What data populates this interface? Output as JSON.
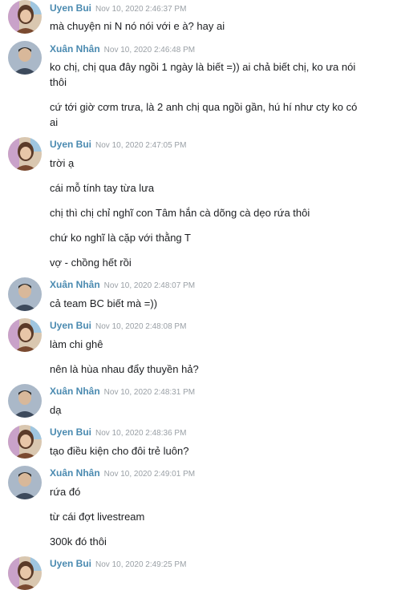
{
  "colors": {
    "sender_name": "#4a8ab0",
    "timestamp": "#9aa0a6",
    "message_text": "#1c1e21"
  },
  "groups": [
    {
      "sender": "Uyen Bui",
      "time": "Nov 10, 2020 2:46:37 PM",
      "avatar": "uyen",
      "messages": [
        "mà chuyện ni N nó nói với e à? hay ai"
      ]
    },
    {
      "sender": "Xuân Nhân",
      "time": "Nov 10, 2020 2:46:48 PM",
      "avatar": "nhan",
      "messages": [
        "ko chị, chị qua đây ngồi 1 ngày là biết =)) ai chả biết chị, ko ưa nói thôi",
        "cứ tới giờ cơm trưa, là 2 anh chị qua ngồi gần, hú hí như cty ko có ai"
      ]
    },
    {
      "sender": "Uyen Bui",
      "time": "Nov 10, 2020 2:47:05 PM",
      "avatar": "uyen",
      "messages": [
        "trời ạ",
        "cái mỗ tính tay từa lưa",
        "chị thì chị chỉ nghĩ con Tâm hắn cà dõng cà dẹo rứa thôi",
        "chứ ko nghĩ là cặp với thằng T",
        "vợ - chồng hết rồi"
      ]
    },
    {
      "sender": "Xuân Nhân",
      "time": "Nov 10, 2020 2:48:07 PM",
      "avatar": "nhan",
      "messages": [
        "cả team BC biết mà =))"
      ]
    },
    {
      "sender": "Uyen Bui",
      "time": "Nov 10, 2020 2:48:08 PM",
      "avatar": "uyen",
      "messages": [
        "làm chi ghê",
        "nên là hùa nhau đẩy thuyền hả?"
      ]
    },
    {
      "sender": "Xuân Nhân",
      "time": "Nov 10, 2020 2:48:31 PM",
      "avatar": "nhan",
      "messages": [
        "dạ"
      ]
    },
    {
      "sender": "Uyen Bui",
      "time": "Nov 10, 2020 2:48:36 PM",
      "avatar": "uyen",
      "messages": [
        "tạo điều kiện cho đôi trẻ luôn?"
      ]
    },
    {
      "sender": "Xuân Nhân",
      "time": "Nov 10, 2020 2:49:01 PM",
      "avatar": "nhan",
      "messages": [
        "rứa đó",
        "từ cái đợt livestream",
        "300k đó thôi"
      ]
    },
    {
      "sender": "Uyen Bui",
      "time": "Nov 10, 2020 2:49:25 PM",
      "avatar": "uyen",
      "messages": []
    }
  ]
}
